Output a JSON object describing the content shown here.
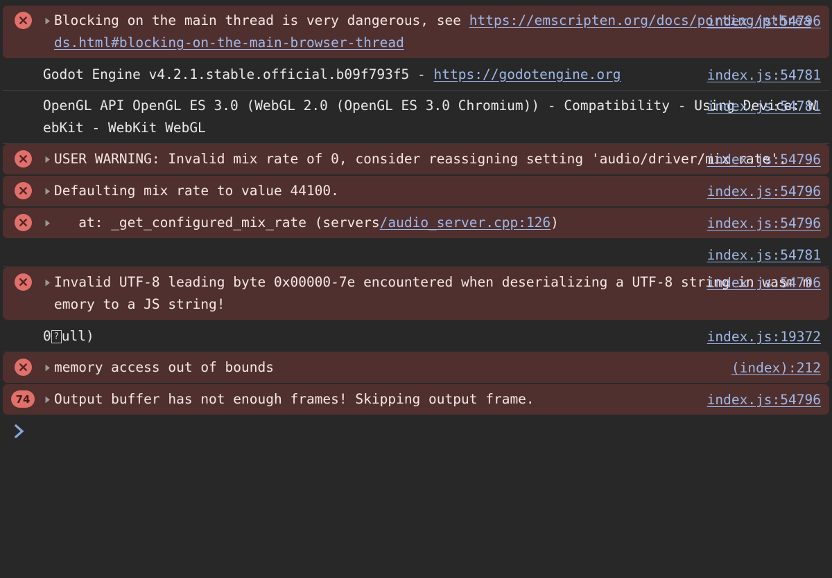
{
  "console": {
    "theme": {
      "background": "#282828",
      "error_row_background": "#4f302f",
      "error_icon_color": "#e26f6a",
      "link_color": "#9fb8e8",
      "text_color": "#f5e7e4",
      "divider_color": "#3b3b3b"
    },
    "prompt": {
      "chevron": "chevron-right-icon",
      "value": "",
      "placeholder": ""
    },
    "messages": [
      {
        "level": "error",
        "icon": "error-circle-icon",
        "expandable": true,
        "disclosure": "triangle-right-icon",
        "text_before_link": "Blocking on the main thread is very dangerous, see ",
        "link_text": "https://emscripten.org/docs/porting/pthreads.html#blocking-on-the-main-browser-thread",
        "text_after_link": "",
        "source": "index.js:54796"
      },
      {
        "level": "log",
        "icon": null,
        "expandable": false,
        "text_before_link": "Godot Engine v4.2.1.stable.official.b09f793f5 - ",
        "link_text": "https://godotengine.org",
        "text_after_link": "",
        "source": "index.js:54781"
      },
      {
        "level": "log",
        "icon": null,
        "expandable": false,
        "text_before_link": "OpenGL API OpenGL ES 3.0 (WebGL 2.0 (OpenGL ES 3.0 Chromium)) - Compatibility - Using Device: WebKit - WebKit WebGL",
        "link_text": "",
        "text_after_link": "",
        "source": "index.js:54781"
      },
      {
        "level": "error",
        "icon": "error-circle-icon",
        "expandable": true,
        "disclosure": "triangle-right-icon",
        "text_before_link": "USER WARNING: Invalid mix rate of 0, consider reassigning setting 'audio/driver/mix_rate'.",
        "link_text": "",
        "text_after_link": "",
        "source": "index.js:54796"
      },
      {
        "level": "error",
        "icon": "error-circle-icon",
        "expandable": true,
        "disclosure": "triangle-right-icon",
        "text_before_link": "Defaulting mix rate to value 44100.",
        "link_text": "",
        "text_after_link": "",
        "source": "index.js:54796"
      },
      {
        "level": "error",
        "icon": "error-circle-icon",
        "expandable": true,
        "disclosure": "triangle-right-icon",
        "text_before_link": "   at: _get_configured_mix_rate (servers",
        "link_text": "/audio_server.cpp:126",
        "text_after_link": ")",
        "source": "index.js:54796"
      },
      {
        "level": "log",
        "icon": null,
        "expandable": false,
        "text_before_link": "",
        "link_text": "",
        "text_after_link": "",
        "source": "index.js:54781"
      },
      {
        "level": "error",
        "icon": "error-circle-icon",
        "expandable": true,
        "disclosure": "triangle-right-icon",
        "text_before_link": "Invalid UTF-8 leading byte 0x00000-7e encountered when deserializing a UTF-8 string in wasm memory to a JS string!",
        "link_text": "",
        "text_after_link": "",
        "source": "index.js:54796"
      },
      {
        "level": "log",
        "icon": null,
        "expandable": false,
        "text_before_link": "0",
        "unprintable_glyph": "?",
        "text_after_link": "ull)",
        "link_text": "",
        "source": "index.js:19372"
      },
      {
        "level": "error",
        "icon": "error-circle-icon",
        "expandable": true,
        "disclosure": "triangle-right-icon",
        "text_before_link": "memory access out of bounds",
        "link_text": "",
        "text_after_link": "",
        "source": "(index):212"
      },
      {
        "level": "error",
        "icon": "count-badge",
        "count": "74",
        "expandable": true,
        "disclosure": "triangle-right-icon",
        "text_before_link": "Output buffer has not enough frames! Skipping output frame.",
        "link_text": "",
        "text_after_link": "",
        "source": "index.js:54796"
      }
    ]
  }
}
